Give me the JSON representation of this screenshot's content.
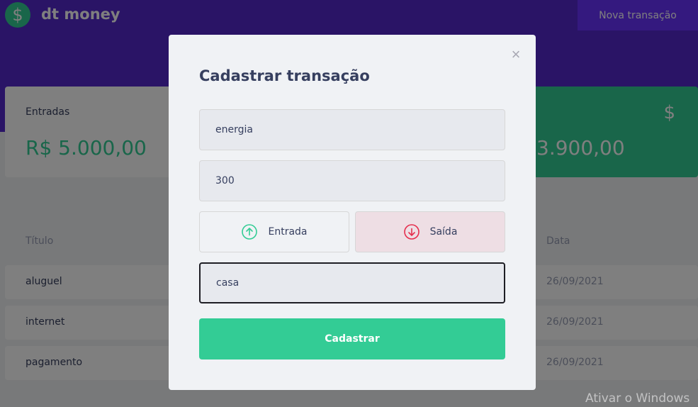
{
  "header": {
    "logo_icon": "dollar-icon",
    "logo_glyph": "$",
    "brand": "dt money",
    "new_button": "Nova transação"
  },
  "summary": {
    "income_label": "Entradas",
    "income_value": "R$ 5.000,00",
    "total_value": "3.900,00",
    "total_icon": "dollar-icon",
    "total_glyph": "$"
  },
  "table": {
    "headers": [
      "Título",
      "Data"
    ],
    "rows": [
      {
        "title": "aluguel",
        "date": "26/09/2021"
      },
      {
        "title": "internet",
        "date": "26/09/2021"
      },
      {
        "title": "pagamento",
        "date": "26/09/2021"
      }
    ]
  },
  "modal": {
    "close_glyph": "×",
    "title": "Cadastrar transação",
    "title_value": "energia",
    "amount_value": "300",
    "type_income": "Entrada",
    "type_outcome": "Saída",
    "category_value": "casa",
    "submit": "Cadastrar"
  },
  "watermark": "Ativar o Windows",
  "colors": {
    "header": "#5429cc",
    "accent_button": "#6933ff",
    "green": "#33cc95",
    "red": "#e52e4d",
    "text": "#363f5f",
    "muted": "#969cb3"
  }
}
